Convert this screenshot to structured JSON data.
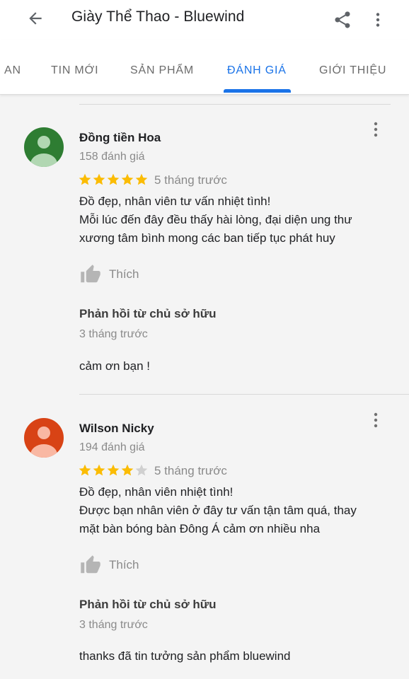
{
  "header": {
    "title": "Giày Thể Thao - Bluewind",
    "back_icon": "arrow-left-icon",
    "share_icon": "share-icon",
    "more_icon": "more-vert-icon"
  },
  "tabs": [
    {
      "label": "AN",
      "active": false
    },
    {
      "label": "TIN MỚI",
      "active": false
    },
    {
      "label": "SẢN PHẨM",
      "active": false
    },
    {
      "label": "ĐÁNH GIÁ",
      "active": true
    },
    {
      "label": "GIỚI THIỆU",
      "active": false
    }
  ],
  "colors": {
    "accent": "#1a73e8",
    "star_filled": "#fbbc04",
    "star_empty": "#d0d0d0",
    "avatar_green": "#2e7d32",
    "avatar_red": "#d84315"
  },
  "reviews": [
    {
      "name": "Đồng tiền Hoa",
      "review_count": "158 đánh giá",
      "rating": 5,
      "time": "5 tháng trước",
      "text_lines": [
        "Đồ đẹp, nhân viên tư vấn nhiệt tình!",
        "Mỗi lúc đến đây đều thấy hài lòng, đại diện ung thư",
        "xương  tâm bình mong các ban tiếp tục phát huy"
      ],
      "like_label": "Thích",
      "owner_reply": {
        "title": "Phản hồi từ chủ sở hữu",
        "time": "3 tháng trước",
        "text": "cảm ơn bạn !"
      }
    },
    {
      "name": "Wilson Nicky",
      "review_count": "194 đánh giá",
      "rating": 4,
      "time": "5 tháng trước",
      "text_lines": [
        "Đồ đẹp, nhân viên nhiệt tình!",
        "Được bạn nhân viên ở đây tư vấn tận tâm quá, thay",
        "mặt bàn bóng bàn Đông Á cảm ơn nhiều nha"
      ],
      "like_label": "Thích",
      "owner_reply": {
        "title": "Phản hồi từ chủ sở hữu",
        "time": "3 tháng trước",
        "text": "thanks đã tin tưởng sản phẩm bluewind"
      }
    }
  ]
}
